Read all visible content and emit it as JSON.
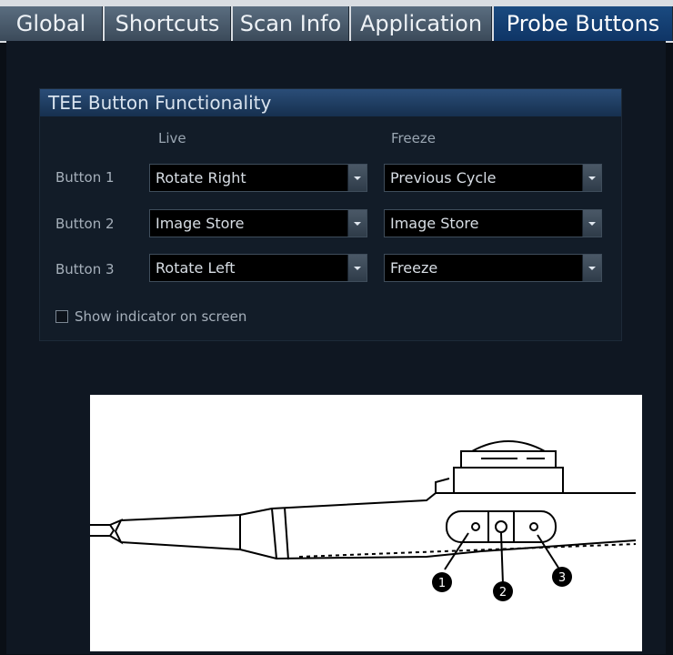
{
  "tabs": [
    "Global",
    "Shortcuts",
    "Scan Info",
    "Application",
    "Probe Buttons"
  ],
  "active_tab": "Probe Buttons",
  "group": {
    "title": "TEE Button Functionality",
    "col_live": "Live",
    "col_freeze": "Freeze",
    "rows": [
      {
        "label": "Button 1",
        "live": "Rotate Right",
        "freeze": "Previous Cycle"
      },
      {
        "label": "Button 2",
        "live": "Image Store",
        "freeze": "Image Store"
      },
      {
        "label": "Button 3",
        "live": "Rotate Left",
        "freeze": "Freeze"
      }
    ],
    "show_indicator_label": "Show indicator on screen",
    "show_indicator_checked": false
  },
  "probe_image": {
    "callouts": [
      "1",
      "2",
      "3"
    ]
  }
}
